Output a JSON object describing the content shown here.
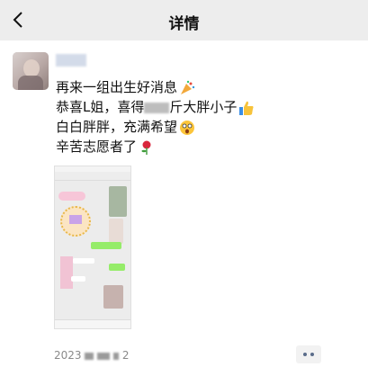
{
  "navbar": {
    "title": "详情",
    "back_icon": "chevron-left-icon"
  },
  "post": {
    "line1": "再来一组出生好消息",
    "line2_a": "恭喜L姐，喜得",
    "line2_b": "斤大胖小子",
    "line3": "白白胖胖，充满希望",
    "line4": "辛苦志愿者了",
    "emojis": [
      "party-popper-icon",
      "thumbs-up-icon",
      "dizzy-face-icon",
      "rose-icon"
    ],
    "date_prefix": "2023",
    "date_suffix": "2"
  },
  "colors": {
    "navbar_bg": "#ededed",
    "link_dots": "#5a6c8a",
    "chat_green": "#95ec69"
  }
}
